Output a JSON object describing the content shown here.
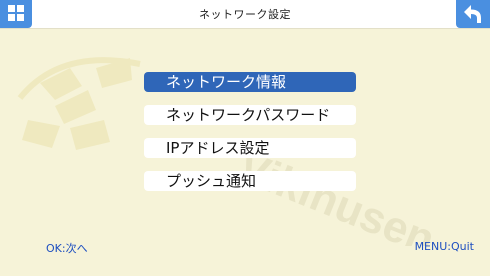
{
  "header": {
    "title": "ネットワーク設定",
    "menu_icon": "grid-icon",
    "back_icon": "return-arrow-icon",
    "accent_color": "#4a8fe0"
  },
  "menu": {
    "items": [
      {
        "label": "ネットワーク情報",
        "selected": true
      },
      {
        "label": "ネットワークパスワード",
        "selected": false
      },
      {
        "label": "IPアドレス設定",
        "selected": false
      },
      {
        "label": "プッシュ通知",
        "selected": false
      }
    ],
    "selected_color": "#2f66b8"
  },
  "footer": {
    "left_hint": "OK:次へ",
    "right_hint": "MENU:Quit",
    "text_color": "#1e4fc0"
  },
  "watermark": {
    "text": "Vikinusen"
  }
}
